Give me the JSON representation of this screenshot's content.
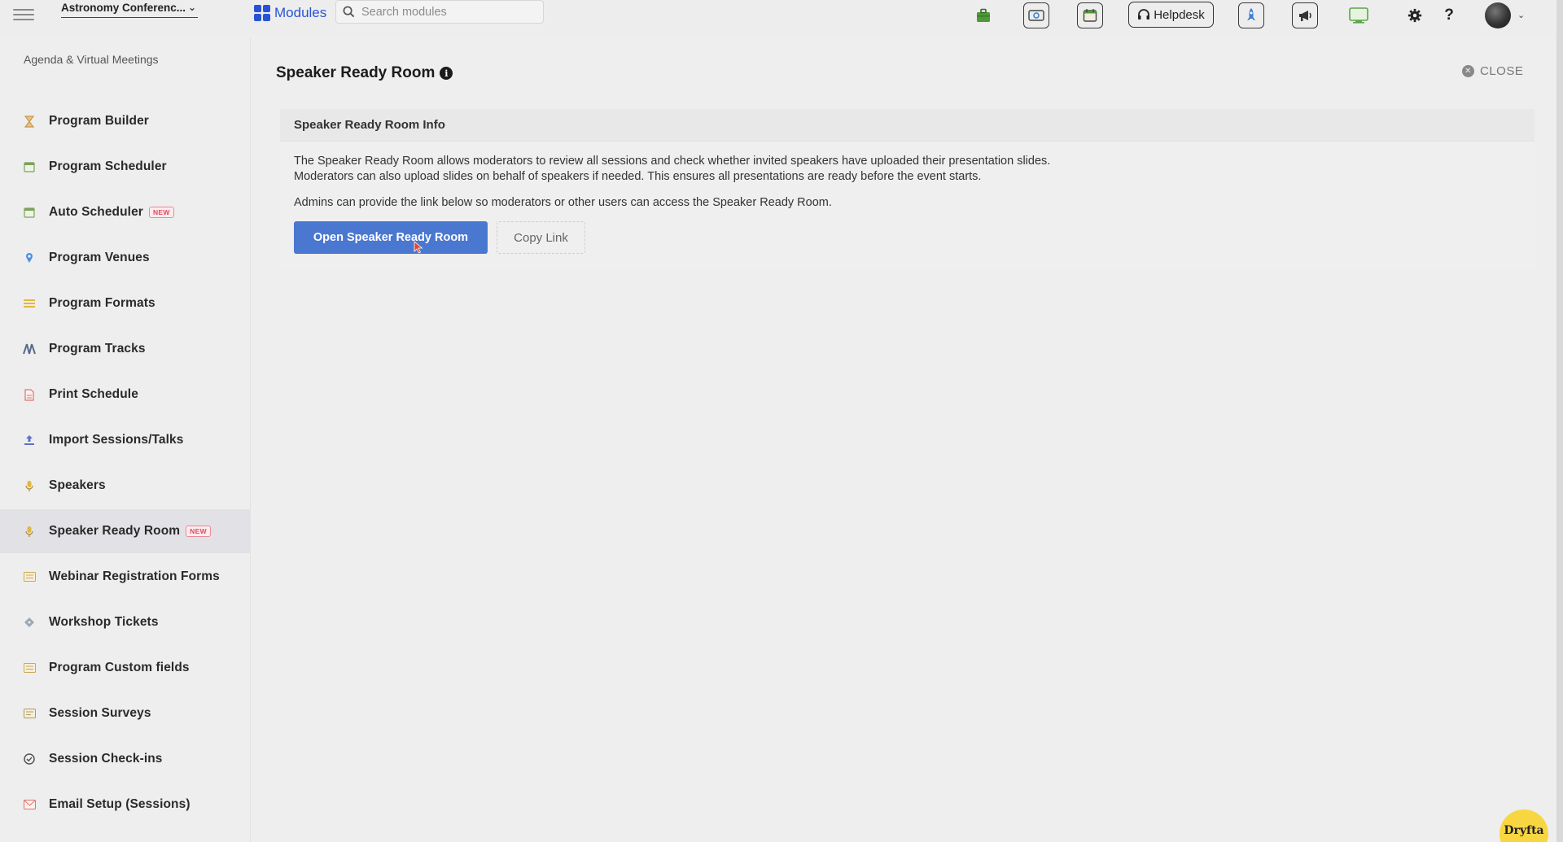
{
  "topbar": {
    "event_name": "Astronomy Conferenc...",
    "modules_label": "Modules",
    "search_placeholder": "Search modules",
    "helpdesk_label": "Helpdesk"
  },
  "sidebar": {
    "heading": "Agenda & Virtual Meetings",
    "new_badge": "NEW",
    "items": [
      {
        "label": "Program Builder",
        "icon": "hourglass-icon"
      },
      {
        "label": "Program Scheduler",
        "icon": "calendar-icon"
      },
      {
        "label": "Auto Scheduler",
        "icon": "calendar-icon",
        "badge": true
      },
      {
        "label": "Program Venues",
        "icon": "map-pin-icon"
      },
      {
        "label": "Program Formats",
        "icon": "list-icon"
      },
      {
        "label": "Program Tracks",
        "icon": "tracks-icon"
      },
      {
        "label": "Print Schedule",
        "icon": "document-icon"
      },
      {
        "label": "Import Sessions/Talks",
        "icon": "upload-icon"
      },
      {
        "label": "Speakers",
        "icon": "microphone-icon"
      },
      {
        "label": "Speaker Ready Room",
        "icon": "microphone-icon",
        "badge": true,
        "active": true
      },
      {
        "label": "Webinar Registration Forms",
        "icon": "form-icon"
      },
      {
        "label": "Workshop Tickets",
        "icon": "ticket-icon"
      },
      {
        "label": "Program Custom fields",
        "icon": "form-icon"
      },
      {
        "label": "Session Surveys",
        "icon": "survey-icon"
      },
      {
        "label": "Session Check-ins",
        "icon": "check-circle-icon"
      },
      {
        "label": "Email Setup (Sessions)",
        "icon": "email-icon"
      }
    ]
  },
  "main": {
    "title": "Speaker Ready Room",
    "close_label": "CLOSE",
    "panel": {
      "header": "Speaker Ready Room Info",
      "paragraph_1_line_1": "The Speaker Ready Room allows moderators to review all sessions and check whether invited speakers have uploaded their presentation slides.",
      "paragraph_1_line_2": "Moderators can also upload slides on behalf of speakers if needed. This ensures all presentations are ready before the event starts.",
      "paragraph_2": "Admins can provide the link below so moderators or other users can access the Speaker Ready Room.",
      "open_button": "Open Speaker Ready Room",
      "copy_button": "Copy Link"
    }
  },
  "brand_badge": "Dryfta",
  "colors": {
    "accent": "#4a77d0",
    "modules_blue": "#2853d6",
    "badge_red": "#e04a5e",
    "brand_yellow": "#f7d642"
  }
}
